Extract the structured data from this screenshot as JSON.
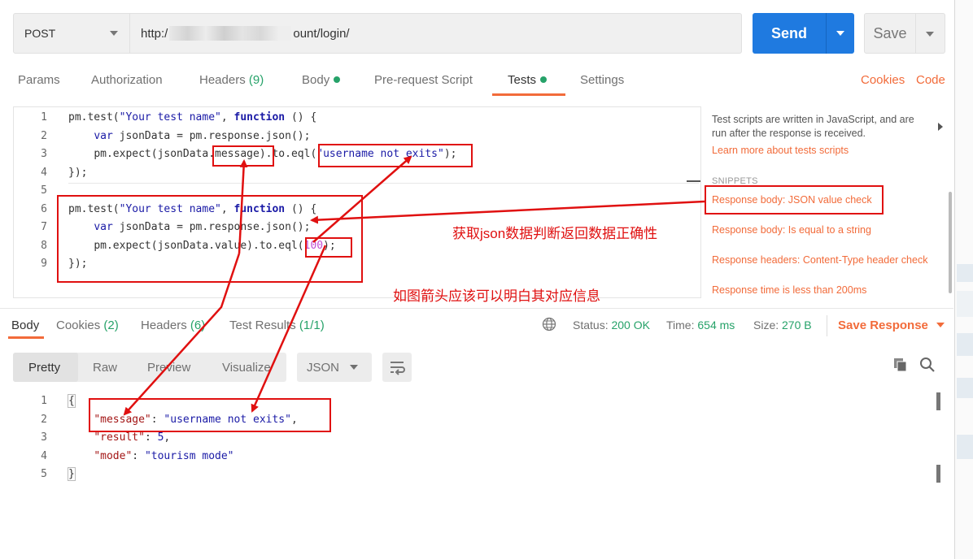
{
  "request": {
    "method": "POST",
    "url_prefix": "http:/",
    "url_suffix": "ount/login/",
    "send_label": "Send",
    "save_label": "Save"
  },
  "request_tabs": {
    "params": "Params",
    "authorization": "Authorization",
    "headers": "Headers",
    "headers_count": "(9)",
    "body": "Body",
    "prerequest": "Pre-request Script",
    "tests": "Tests",
    "settings": "Settings",
    "cookies": "Cookies",
    "code": "Code",
    "active": "Tests"
  },
  "editor": {
    "line_numbers": [
      "1",
      "2",
      "3",
      "4",
      "5",
      "6",
      "7",
      "8",
      "9"
    ],
    "tokens": {
      "pm_test": "pm.test",
      "open_paren": "(",
      "test_name": "\"Your test name\"",
      "comma": ", ",
      "function_kw": "function",
      "fn_tail": " () {",
      "var_kw": "var",
      "json_decl": " jsonData = pm.response.json();",
      "expect_head": "pm.expect(jsonData.",
      "message": "message",
      "value": "value",
      "to_eql": ").to.eql(",
      "str_username": "\"username not exits\"",
      "close_call": ");",
      "num_100": "100",
      "close_block": "});"
    }
  },
  "side_panel": {
    "info": "Test scripts are written in JavaScript, and are run after the response is received.",
    "learn_more": "Learn more about tests scripts",
    "snippets_heading": "SNIPPETS",
    "snippets": [
      "Response body: JSON value check",
      "Response body: Is equal to a string",
      "Response headers: Content-Type header check",
      "Response time is less than 200ms"
    ]
  },
  "response_tabs": {
    "body": "Body",
    "cookies": "Cookies",
    "cookies_count": "(2)",
    "headers": "Headers",
    "headers_count": "(6)",
    "test_results": "Test Results",
    "test_results_count": "(1/1)"
  },
  "response_status": {
    "status_label": "Status:",
    "status_value": "200 OK",
    "time_label": "Time:",
    "time_value": "654 ms",
    "size_label": "Size:",
    "size_value": "270 B",
    "save_response": "Save Response"
  },
  "response_view": {
    "modes": [
      "Pretty",
      "Raw",
      "Preview",
      "Visualize"
    ],
    "active_mode": "Pretty",
    "format": "JSON"
  },
  "response_body": {
    "line_numbers": [
      "1",
      "2",
      "3",
      "4",
      "5"
    ],
    "open_brace": "{",
    "close_brace": "}",
    "k_message": "\"message\"",
    "v_message": "\"username not exits\"",
    "k_result": "\"result\"",
    "v_result": "5",
    "k_mode": "\"mode\"",
    "v_mode": "\"tourism mode\""
  },
  "annotations": {
    "note_1": "获取json数据判断返回数据正确性",
    "note_2": "如图箭头应该可以明白其对应信息"
  },
  "colors": {
    "accent_orange": "#f26b3a",
    "send_blue": "#1f7ae0",
    "success_green": "#26a269",
    "annotation_red": "#e01010"
  }
}
